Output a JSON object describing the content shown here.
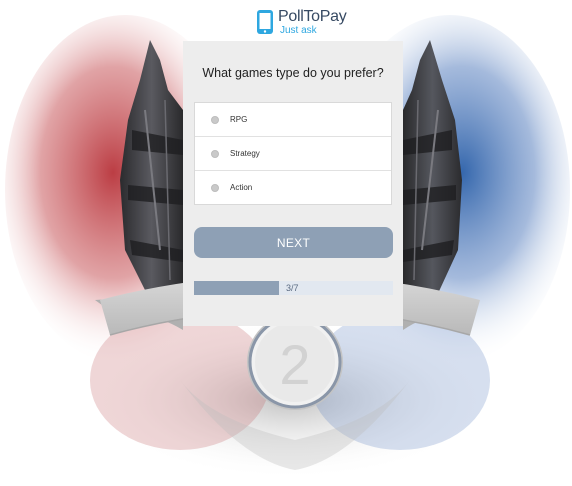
{
  "logo": {
    "name": "PollToPay",
    "tagline": "Just ask",
    "icon": "phone-icon"
  },
  "poll": {
    "question": "What games type do you prefer?",
    "options": [
      {
        "label": "RPG",
        "selected": false
      },
      {
        "label": "Strategy",
        "selected": false
      },
      {
        "label": "Action",
        "selected": false
      }
    ],
    "next_label": "NEXT",
    "progress": {
      "text": "3/7",
      "current": 3,
      "total": 7
    }
  },
  "badge": {
    "number": "2"
  },
  "colors": {
    "accent": "#8ea0b5",
    "brand_dark": "#374a63",
    "brand_light": "#2ea7e0",
    "splash_red": "#c0392b",
    "splash_blue": "#2a5fa8"
  }
}
